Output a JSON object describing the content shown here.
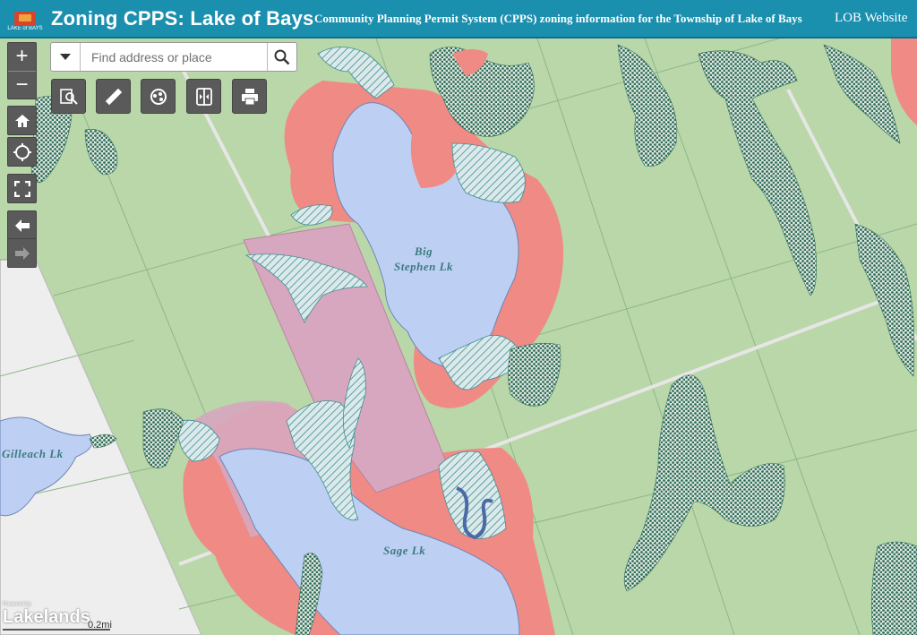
{
  "header": {
    "logo_text": "LAKE of BAYS",
    "title": "Zoning CPPS: Lake of Bays",
    "subtitle": "Community Planning Permit System (CPPS) zoning information for the Township of Lake of Bays",
    "website_link": "LOB Website"
  },
  "search": {
    "placeholder": "Find address or place"
  },
  "toolbar": {
    "widgets": [
      "search-layer-icon",
      "measure-icon",
      "layers-icon",
      "swipe-icon",
      "print-icon"
    ]
  },
  "navigation": {
    "zoom_in": "+",
    "zoom_out": "−"
  },
  "map": {
    "lake_labels": [
      {
        "line1": "Big",
        "line2": "Stephen Lk"
      },
      {
        "line1": "Sage Lk",
        "line2": ""
      },
      {
        "line1": "Gilleach Lk",
        "line2": ""
      }
    ],
    "scale_label": "0.2mi",
    "attribution": "Lakelands",
    "attribution_small": "Powered by",
    "colors": {
      "zone_green": "#b9d7a8",
      "zone_red": "#ef8a84",
      "zone_purple": "#d7a6bf",
      "water_blue": "#bdd0f4",
      "hatch_teal": "#3e8f93",
      "gray_area": "#eeeeee"
    }
  }
}
